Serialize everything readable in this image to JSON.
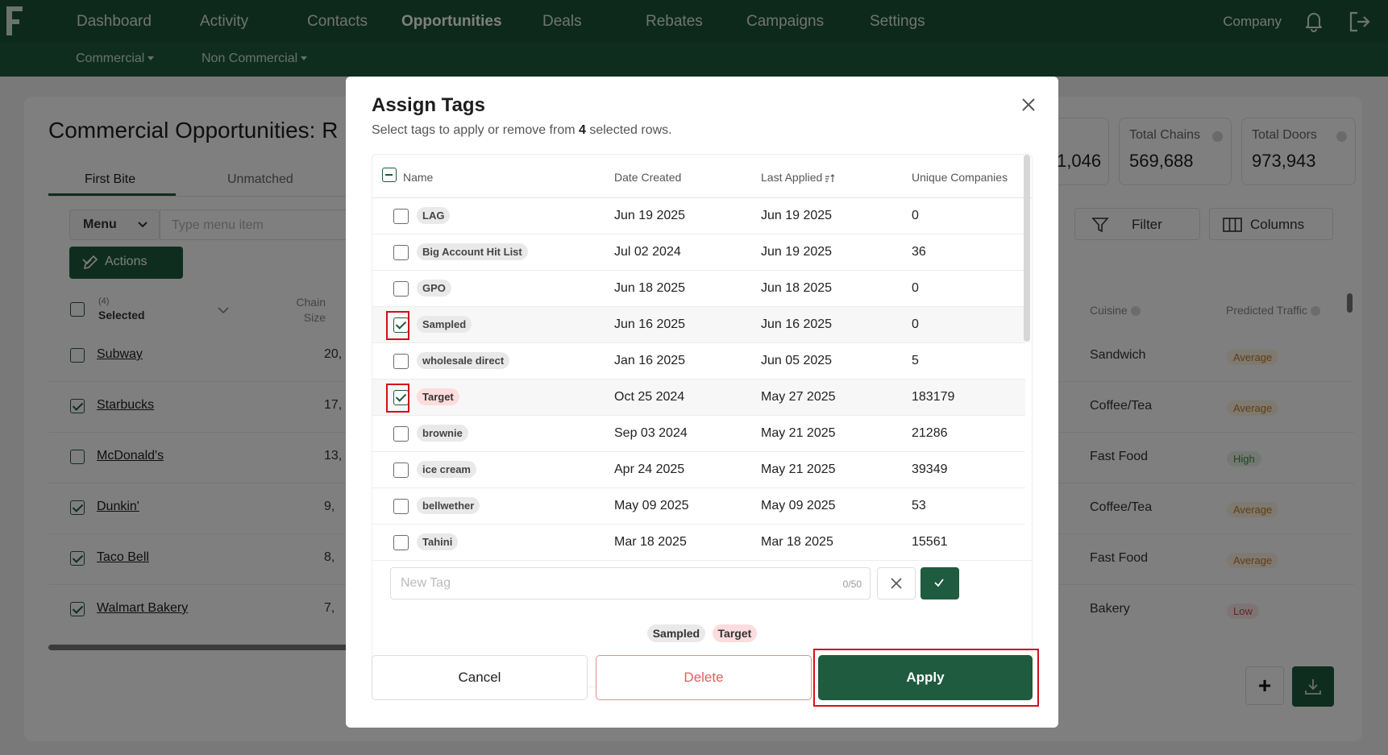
{
  "nav": {
    "items": [
      "Dashboard",
      "Activity",
      "Contacts",
      "Opportunities",
      "Deals",
      "Rebates",
      "Campaigns",
      "Settings"
    ],
    "active": "Opportunities",
    "sub_items": [
      "Commercial",
      "Non Commercial"
    ],
    "company": "Company"
  },
  "page": {
    "title": "Commercial Opportunities: R",
    "tabs": [
      "First Bite",
      "Unmatched"
    ],
    "menu_label": "Menu",
    "menu_placeholder": "Type menu item",
    "actions_label": "Actions",
    "selected_count": "(4)",
    "selected_label": "Selected",
    "chain_size_header": "Chain Size",
    "rows": [
      {
        "name": "Subway",
        "size": "20,",
        "checked": false,
        "cuisine": "Sandwich",
        "traffic": "Average"
      },
      {
        "name": "Starbucks",
        "size": "17,",
        "checked": true,
        "cuisine": "Coffee/Tea",
        "traffic": "Average"
      },
      {
        "name": "McDonald's",
        "size": "13,",
        "checked": false,
        "cuisine": "Fast Food",
        "traffic": "High"
      },
      {
        "name": "Dunkin'",
        "size": "9,",
        "checked": true,
        "cuisine": "Coffee/Tea",
        "traffic": "Average"
      },
      {
        "name": "Taco Bell",
        "size": "8,",
        "checked": true,
        "cuisine": "Fast Food",
        "traffic": "Average"
      },
      {
        "name": "Walmart Bakery",
        "size": "7,",
        "checked": true,
        "cuisine": "Bakery",
        "traffic": "Low"
      }
    ],
    "stats": [
      {
        "label": "",
        "value": "1,046"
      },
      {
        "label": "Total Chains",
        "value": "569,688"
      },
      {
        "label": "Total Doors",
        "value": "973,943"
      }
    ],
    "filter_label": "Filter",
    "columns_label": "Columns",
    "cuisine_header": "Cuisine",
    "traffic_header": "Predicted Traffic",
    "plus_label": "+"
  },
  "modal": {
    "title": "Assign Tags",
    "subtitle_pre": "Select tags to apply or remove from ",
    "subtitle_count": "4",
    "subtitle_post": " selected rows.",
    "columns": [
      "Name",
      "Date Created",
      "Last Applied",
      "Unique Companies"
    ],
    "rows": [
      {
        "tag": "LAG",
        "created": "Jun 19 2025",
        "applied": "Jun 19 2025",
        "companies": "0",
        "checked": false
      },
      {
        "tag": "Big Account Hit List",
        "created": "Jul 02 2024",
        "applied": "Jun 19 2025",
        "companies": "36",
        "checked": false
      },
      {
        "tag": "GPO",
        "created": "Jun 18 2025",
        "applied": "Jun 18 2025",
        "companies": "0",
        "checked": false
      },
      {
        "tag": "Sampled",
        "created": "Jun 16 2025",
        "applied": "Jun 16 2025",
        "companies": "0",
        "checked": true
      },
      {
        "tag": "wholesale direct",
        "created": "Jan 16 2025",
        "applied": "Jun 05 2025",
        "companies": "5",
        "checked": false
      },
      {
        "tag": "Target",
        "created": "Oct 25 2024",
        "applied": "May 27 2025",
        "companies": "183179",
        "checked": true
      },
      {
        "tag": "brownie",
        "created": "Sep 03 2024",
        "applied": "May 21 2025",
        "companies": "21286",
        "checked": false
      },
      {
        "tag": "ice cream",
        "created": "Apr 24 2025",
        "applied": "May 21 2025",
        "companies": "39349",
        "checked": false
      },
      {
        "tag": "bellwether",
        "created": "May 09 2025",
        "applied": "May 09 2025",
        "companies": "53",
        "checked": false
      },
      {
        "tag": "Tahini",
        "created": "Mar 18 2025",
        "applied": "Mar 18 2025",
        "companies": "15561",
        "checked": false
      }
    ],
    "new_tag_placeholder": "New Tag",
    "new_tag_count": "0/50",
    "selected_chips": [
      "Sampled",
      "Target"
    ],
    "cancel_label": "Cancel",
    "delete_label": "Delete",
    "apply_label": "Apply"
  }
}
